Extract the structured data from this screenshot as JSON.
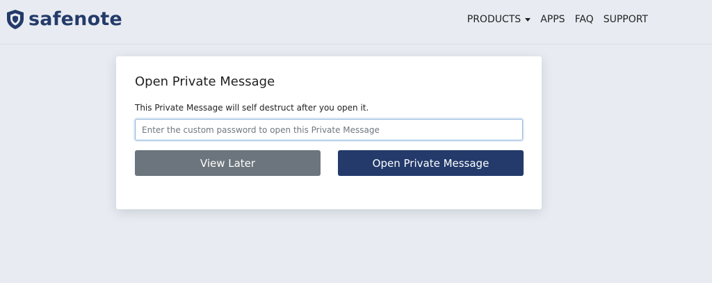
{
  "header": {
    "logo_text": "safenote",
    "nav": {
      "products": "PRODUCTS",
      "apps": "APPS",
      "faq": "FAQ",
      "support": "SUPPORT"
    }
  },
  "card": {
    "title": "Open Private Message",
    "description": "This Private Message will self destruct after you open it.",
    "password_input": {
      "value": "",
      "placeholder": "Enter the custom password to open this Private Message"
    },
    "view_later_label": "View Later",
    "open_label": "Open Private Message"
  },
  "colors": {
    "brand": "#243a6a",
    "page_background": "#e8ecf2",
    "view_later_button": "#6c757d",
    "open_button": "#233a6b",
    "input_focus_border": "#8fb4dc"
  },
  "icons": {
    "logo": "shield-icon",
    "products_dropdown": "caret-down-icon"
  }
}
